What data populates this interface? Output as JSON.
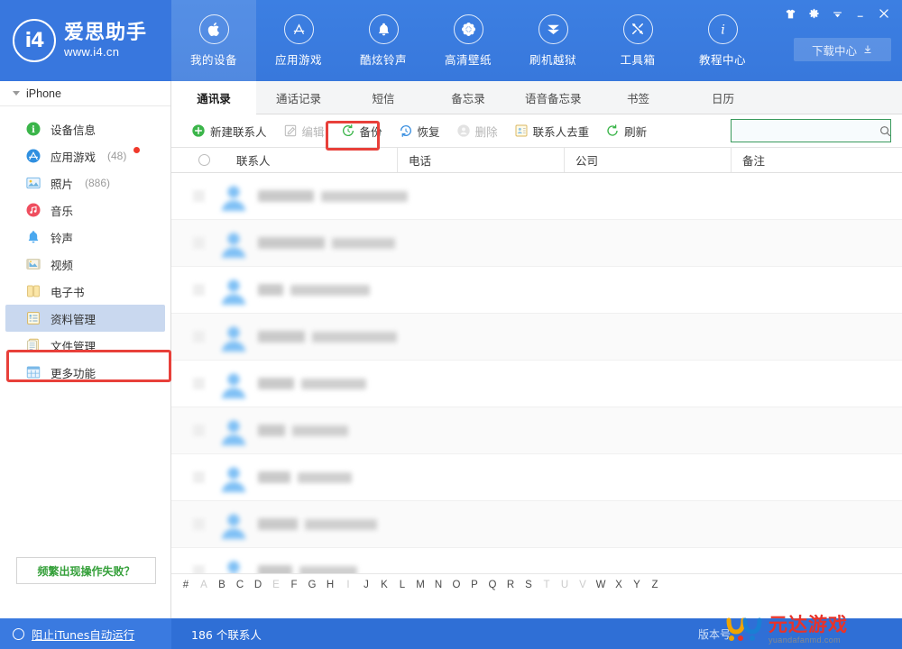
{
  "app": {
    "brand_name": "爱思助手",
    "brand_url": "www.i4.cn",
    "logo_glyph": "i4"
  },
  "header": {
    "nav": [
      {
        "label": "我的设备",
        "icon": "apple-icon",
        "active": true
      },
      {
        "label": "应用游戏",
        "icon": "appstore-icon",
        "active": false
      },
      {
        "label": "酷炫铃声",
        "icon": "bell-icon",
        "active": false
      },
      {
        "label": "高清壁纸",
        "icon": "flower-icon",
        "active": false
      },
      {
        "label": "刷机越狱",
        "icon": "flash-icon",
        "active": false
      },
      {
        "label": "工具箱",
        "icon": "tools-icon",
        "active": false
      },
      {
        "label": "教程中心",
        "icon": "info-icon",
        "active": false
      }
    ],
    "window_buttons": [
      {
        "name": "skin-icon",
        "glyph": "skin"
      },
      {
        "name": "settings-gear-icon",
        "glyph": "gear"
      },
      {
        "name": "menu-chevron-down-icon",
        "glyph": "chevron"
      },
      {
        "name": "minimize-icon",
        "glyph": "minimize"
      },
      {
        "name": "close-icon",
        "glyph": "close"
      }
    ],
    "download_center": "下载中心"
  },
  "sidebar": {
    "device_name": "iPhone",
    "items": [
      {
        "label": "设备信息",
        "icon": "info-circle-icon",
        "count": "",
        "badge": false,
        "selected": false
      },
      {
        "label": "应用游戏",
        "icon": "appstore-icon",
        "count": "(48)",
        "badge": true,
        "selected": false
      },
      {
        "label": "照片",
        "icon": "photo-icon",
        "count": "(886)",
        "badge": false,
        "selected": false
      },
      {
        "label": "音乐",
        "icon": "music-icon",
        "count": "",
        "badge": false,
        "selected": false
      },
      {
        "label": "铃声",
        "icon": "ringtone-bell-icon",
        "count": "",
        "badge": false,
        "selected": false
      },
      {
        "label": "视频",
        "icon": "video-icon",
        "count": "",
        "badge": false,
        "selected": false
      },
      {
        "label": "电子书",
        "icon": "book-icon",
        "count": "",
        "badge": false,
        "selected": false
      },
      {
        "label": "资料管理",
        "icon": "data-card-icon",
        "count": "",
        "badge": false,
        "selected": true
      },
      {
        "label": "文件管理",
        "icon": "files-icon",
        "count": "",
        "badge": false,
        "selected": false
      },
      {
        "label": "更多功能",
        "icon": "grid-more-icon",
        "count": "",
        "badge": false,
        "selected": false
      }
    ],
    "help_link": "频繁出现操作失败？"
  },
  "main": {
    "tabs": [
      {
        "label": "通讯录",
        "active": true
      },
      {
        "label": "通话记录",
        "active": false
      },
      {
        "label": "短信",
        "active": false
      },
      {
        "label": "备忘录",
        "active": false
      },
      {
        "label": "语音备忘录",
        "active": false
      },
      {
        "label": "书签",
        "active": false
      },
      {
        "label": "日历",
        "active": false
      }
    ],
    "toolbar": [
      {
        "label": "新建联系人",
        "icon": "plus-circle-icon",
        "disabled": false
      },
      {
        "label": "编辑",
        "icon": "edit-pencil-icon",
        "disabled": true
      },
      {
        "label": "备份",
        "icon": "backup-arrow-icon",
        "disabled": false
      },
      {
        "label": "恢复",
        "icon": "restore-arrow-icon",
        "disabled": false
      },
      {
        "label": "删除",
        "icon": "delete-person-icon",
        "disabled": true
      },
      {
        "label": "联系人去重",
        "icon": "dedupe-card-icon",
        "disabled": false
      },
      {
        "label": "刷新",
        "icon": "refresh-icon",
        "disabled": false
      }
    ],
    "search": {
      "value": "",
      "placeholder": ""
    },
    "columns": [
      "联系人",
      "电话",
      "公司",
      "备注"
    ],
    "rows": [
      {
        "name": "",
        "phone": "",
        "company": "",
        "note": "",
        "name_w": 62,
        "phone_w": 96
      },
      {
        "name": "",
        "phone": "",
        "company": "",
        "note": "",
        "name_w": 74,
        "phone_w": 70
      },
      {
        "name": "",
        "phone": "",
        "company": "",
        "note": "",
        "name_w": 28,
        "phone_w": 88
      },
      {
        "name": "",
        "phone": "",
        "company": "",
        "note": "",
        "name_w": 52,
        "phone_w": 94
      },
      {
        "name": "",
        "phone": "",
        "company": "",
        "note": "",
        "name_w": 40,
        "phone_w": 72
      },
      {
        "name": "",
        "phone": "",
        "company": "",
        "note": "",
        "name_w": 30,
        "phone_w": 62
      },
      {
        "name": "",
        "phone": "",
        "company": "",
        "note": "",
        "name_w": 36,
        "phone_w": 60
      },
      {
        "name": "",
        "phone": "",
        "company": "",
        "note": "",
        "name_w": 44,
        "phone_w": 80
      },
      {
        "name": "",
        "phone": "",
        "company": "",
        "note": "",
        "name_w": 38,
        "phone_w": 64
      }
    ],
    "alphabet": [
      {
        "ch": "#",
        "dim": false
      },
      {
        "ch": "A",
        "dim": true
      },
      {
        "ch": "B",
        "dim": false
      },
      {
        "ch": "C",
        "dim": false
      },
      {
        "ch": "D",
        "dim": false
      },
      {
        "ch": "E",
        "dim": true
      },
      {
        "ch": "F",
        "dim": false
      },
      {
        "ch": "G",
        "dim": false
      },
      {
        "ch": "H",
        "dim": false
      },
      {
        "ch": "I",
        "dim": true
      },
      {
        "ch": "J",
        "dim": false
      },
      {
        "ch": "K",
        "dim": false
      },
      {
        "ch": "L",
        "dim": false
      },
      {
        "ch": "M",
        "dim": false
      },
      {
        "ch": "N",
        "dim": false
      },
      {
        "ch": "O",
        "dim": false
      },
      {
        "ch": "P",
        "dim": false
      },
      {
        "ch": "Q",
        "dim": false
      },
      {
        "ch": "R",
        "dim": false
      },
      {
        "ch": "S",
        "dim": false
      },
      {
        "ch": "T",
        "dim": true
      },
      {
        "ch": "U",
        "dim": true
      },
      {
        "ch": "V",
        "dim": true
      },
      {
        "ch": "W",
        "dim": false
      },
      {
        "ch": "X",
        "dim": false
      },
      {
        "ch": "Y",
        "dim": false
      },
      {
        "ch": "Z",
        "dim": false
      }
    ]
  },
  "statusbar": {
    "itunes_toggle": "阻止iTunes自动运行",
    "contact_count": "186 个联系人",
    "version_label": "版本号"
  },
  "watermark": {
    "cn": "元达游戏",
    "en": "yuandafanmd.com"
  },
  "colors": {
    "header_blue": "#3878dc",
    "status_blue": "#2f6fd6",
    "accent_green": "#35a03a",
    "annotation_red": "#e8403a",
    "selected_row": "#c9d8ef",
    "search_border": "#3a9a5c",
    "badge_red": "#f0392b"
  }
}
